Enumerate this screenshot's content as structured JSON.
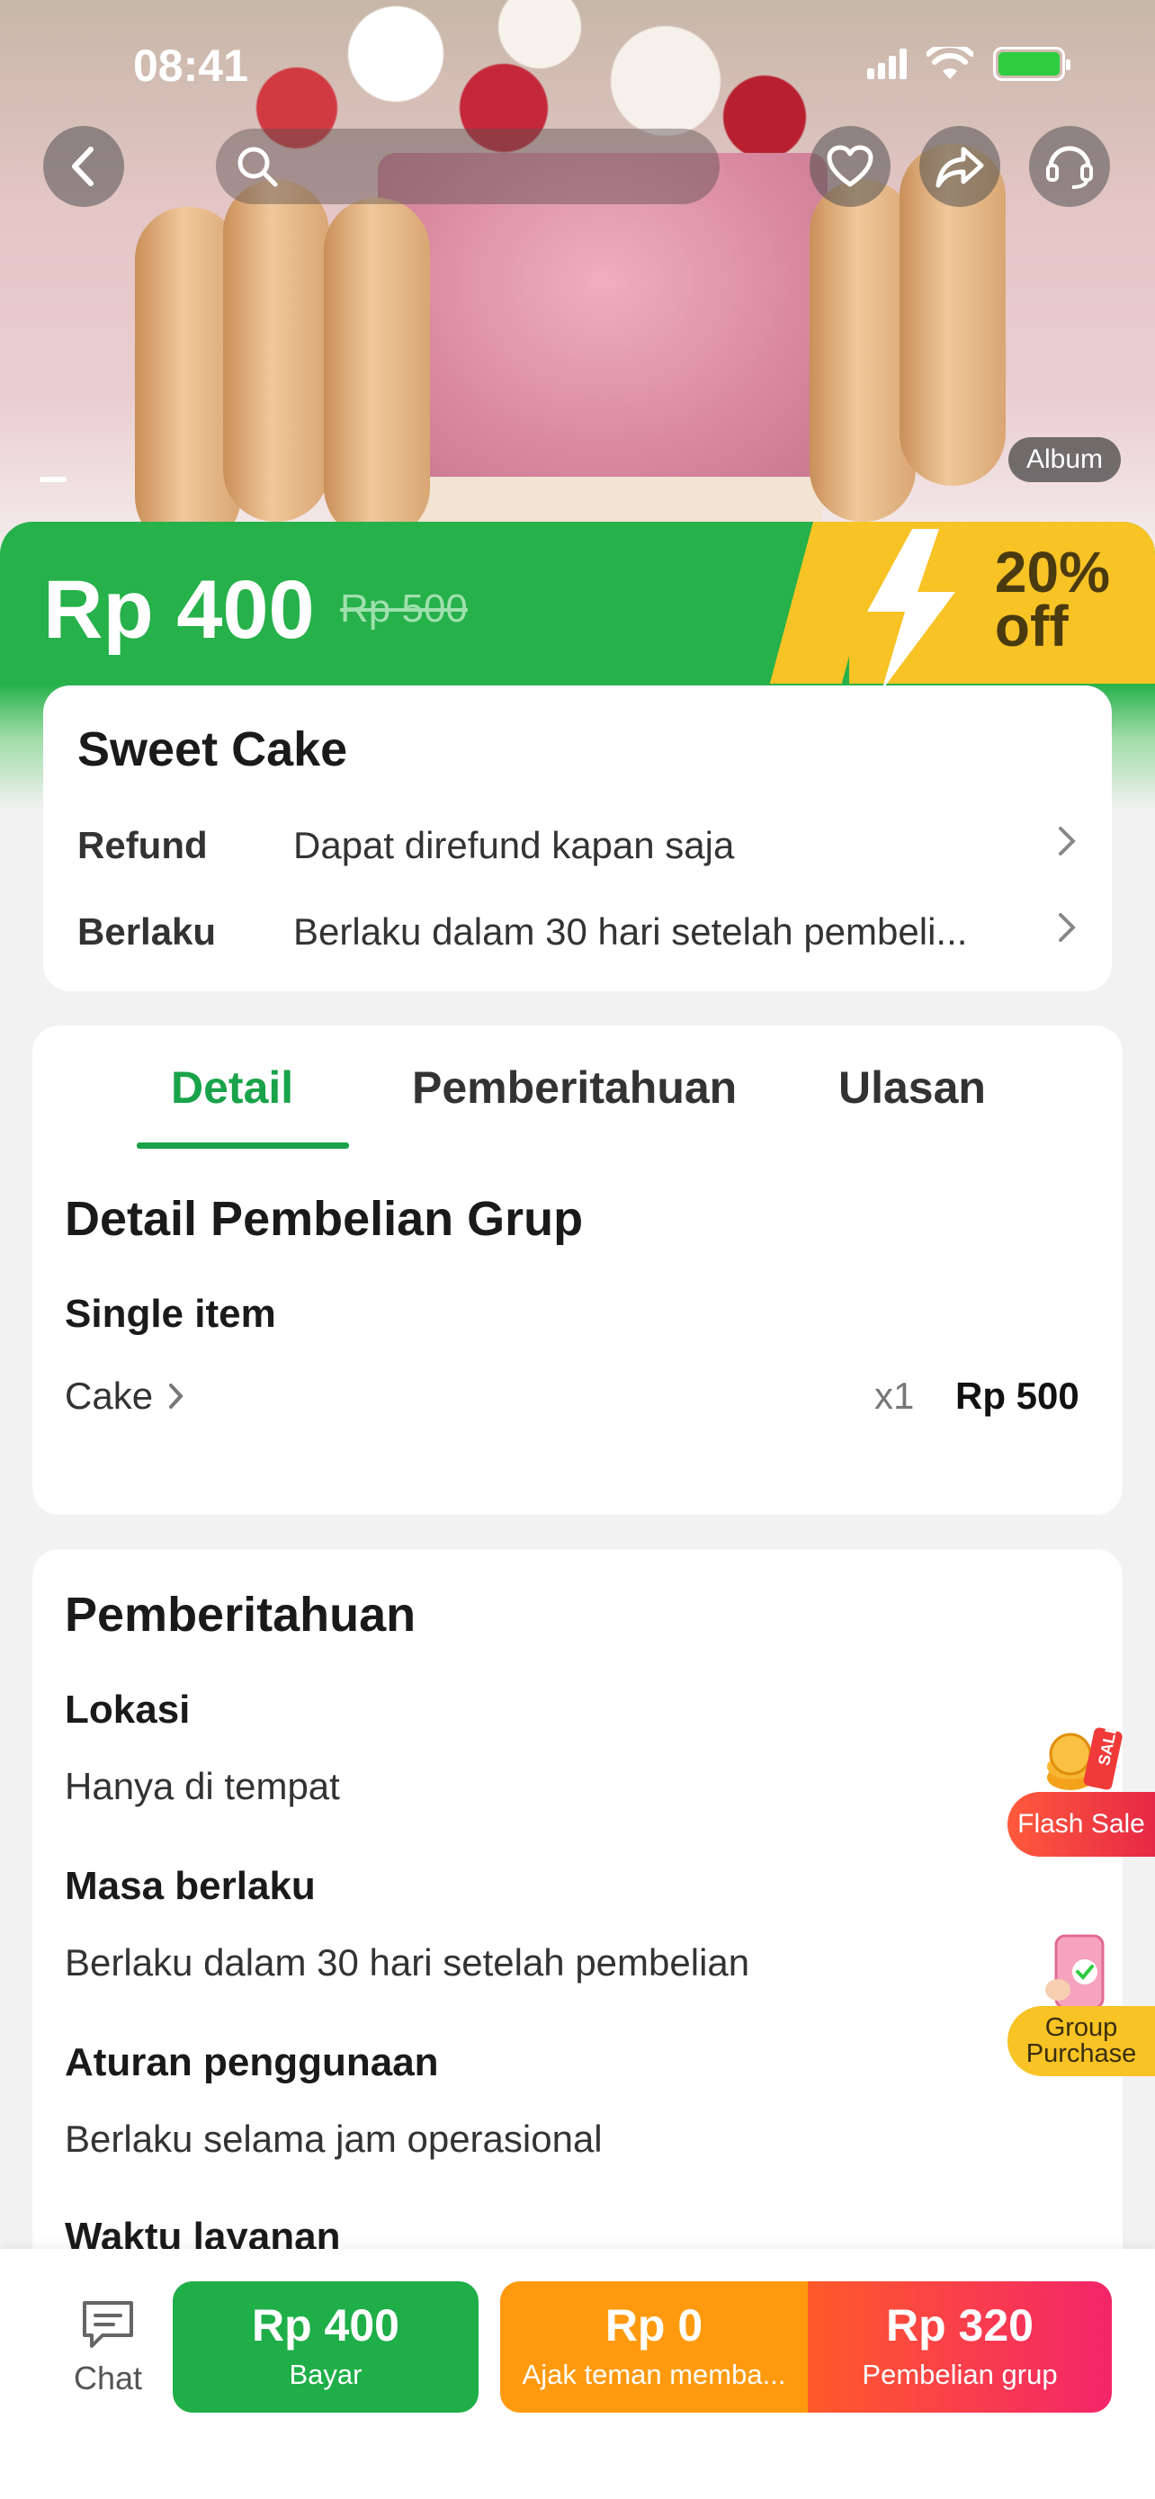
{
  "status_bar": {
    "time": "08:41"
  },
  "hero": {
    "album_label": "Album"
  },
  "price": {
    "current": "Rp 400",
    "original": "Rp 500",
    "discount": "20%\noff"
  },
  "info": {
    "title": "Sweet Cake",
    "rows": [
      {
        "key": "Refund",
        "value": "Dapat direfund kapan saja"
      },
      {
        "key": "Berlaku",
        "value": "Berlaku dalam 30 hari setelah pembeli..."
      }
    ]
  },
  "tabs": {
    "detail": "Detail",
    "notice": "Pemberitahuan",
    "review": "Ulasan"
  },
  "detail": {
    "title": "Detail Pembelian Grup",
    "subtitle": "Single item",
    "item_name": "Cake",
    "item_qty": "x1",
    "item_price": "Rp 500"
  },
  "notice": {
    "title": "Pemberitahuan",
    "sections": [
      {
        "label": "Lokasi",
        "value": "Hanya di tempat"
      },
      {
        "label": "Masa berlaku",
        "value": "Berlaku dalam 30 hari setelah pembelian"
      },
      {
        "label": "Aturan penggunaan",
        "value": "Berlaku selama jam operasional"
      },
      {
        "label": "Waktu layanan"
      }
    ]
  },
  "floating": {
    "flash_sale": "Flash Sale",
    "group_purchase": "Group\nPurchase",
    "sale_tag": "SALE"
  },
  "bottom_bar": {
    "chat_label": "Chat",
    "pay": {
      "price": "Rp 400",
      "label": "Bayar"
    },
    "invite": {
      "price": "Rp 0",
      "label": "Ajak teman memba..."
    },
    "group": {
      "price": "Rp 320",
      "label": "Pembelian grup"
    }
  },
  "colors": {
    "primary_green": "#1fae48",
    "promo_yellow": "#f7c325",
    "orange": "#ff9a0e",
    "pink_red": "#f3256a"
  }
}
